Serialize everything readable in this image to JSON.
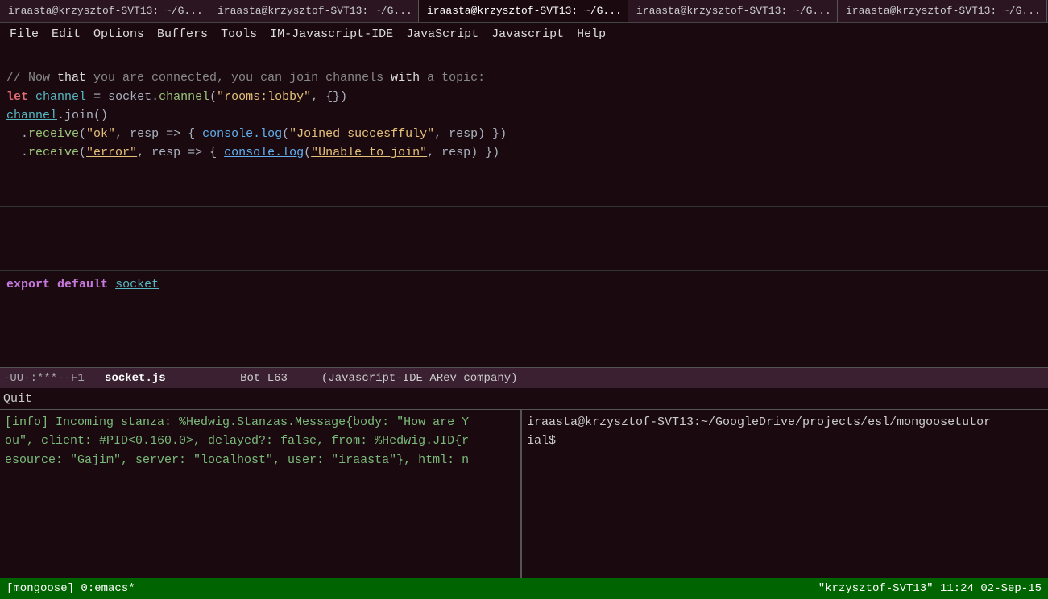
{
  "tabs": [
    {
      "label": "iraasta@krzysztof-SVT13: ~/G...",
      "active": false
    },
    {
      "label": "iraasta@krzysztof-SVT13: ~/G...",
      "active": false
    },
    {
      "label": "iraasta@krzysztof-SVT13: ~/G...",
      "active": true
    },
    {
      "label": "iraasta@krzysztof-SVT13: ~/G...",
      "active": false
    },
    {
      "label": "iraasta@krzysztof-SVT13: ~/G...",
      "active": false
    }
  ],
  "menu": {
    "items": [
      "File",
      "Edit",
      "Options",
      "Buffers",
      "Tools",
      "IM-Javascript-IDE",
      "JavaScript",
      "Javascript",
      "Help"
    ]
  },
  "editor": {
    "lines": [
      {
        "type": "comment",
        "text": "// Now that you are connected, you can join channels with a topic:"
      },
      {
        "type": "code",
        "text": "let channel = socket.channel(\"rooms:lobby\", {})"
      },
      {
        "type": "code",
        "text": "channel.join()"
      },
      {
        "type": "code",
        "text": "  .receive(\"ok\", resp => { console.log(\"Joined succesffuly\", resp) })"
      },
      {
        "type": "code",
        "text": "  .receive(\"error\", resp => { console.log(\"Unable to join\", resp) })"
      }
    ]
  },
  "editor2": {
    "lines": [
      {
        "text": "export default socket"
      }
    ]
  },
  "status_bar": {
    "mode": "-UU-:***--F1",
    "filename": "socket.js",
    "bot": "Bot L63",
    "mode_info": "(Javascript-IDE ARev company)",
    "dashes": "-------------------------------------------------------"
  },
  "mini_buffer": {
    "text": "Quit"
  },
  "bottom_left": {
    "lines": [
      "[info] Incoming stanza: %Hedwig.Stanzas.Message{body: \"How are Y",
      "ou\", client: #PID<0.160.0>, delayed?: false, from: %Hedwig.JID{r",
      "esource: \"Gajim\", server: \"localhost\", user: \"iraasta\"}, html: n"
    ]
  },
  "bottom_right": {
    "line": "iraasta@krzysztof-SVT13:~/GoogleDrive/projects/esl/mongoosetutor",
    "line2": "ial$"
  },
  "bottom_status": {
    "left": "[mongoose] 0:emacs*",
    "right": "\"krzysztof-SVT13\" 11:24  02-Sep-15"
  }
}
